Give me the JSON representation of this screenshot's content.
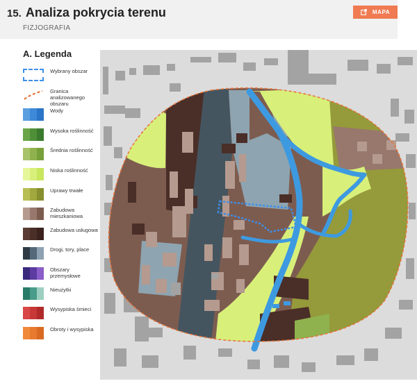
{
  "header": {
    "number": "15.",
    "title": "Analiza pokrycia terenu",
    "subtitle": "FIZJOGRAFIA",
    "map_button_label": "MAPA",
    "map_button_icon": "external-link-icon"
  },
  "legend": {
    "title": "A. Legenda",
    "items": [
      {
        "key": "selected-area",
        "label": "Wybrany obszar",
        "type": "frame",
        "colors": [
          "#3d8ee8"
        ]
      },
      {
        "key": "analysis-boundary",
        "label": "Granica analizowanego obszaru",
        "type": "line",
        "colors": [
          "#e8753a"
        ]
      },
      {
        "key": "water",
        "label": "Wody",
        "type": "ramp",
        "colors": [
          "#5a9fe0",
          "#3e89d8",
          "#2a75c8"
        ]
      },
      {
        "key": "high-vegetation",
        "label": "Wysoka roślinność",
        "type": "ramp",
        "colors": [
          "#6aa548",
          "#4f8f38",
          "#3a7a2c"
        ]
      },
      {
        "key": "medium-vegetation",
        "label": "Średnia roślinność",
        "type": "ramp",
        "colors": [
          "#a8c46a",
          "#8fb24e",
          "#77a03a"
        ]
      },
      {
        "key": "low-vegetation",
        "label": "Niska roślinność",
        "type": "ramp",
        "colors": [
          "#e6f79a",
          "#d8f07a",
          "#c8e65e"
        ]
      },
      {
        "key": "permanent-crops",
        "label": "Uprawy trwałe",
        "type": "ramp",
        "colors": [
          "#b8be54",
          "#a0a83e",
          "#888f2e"
        ]
      },
      {
        "key": "residential",
        "label": "Zabudowa mieszkaniowa",
        "type": "ramp",
        "colors": [
          "#b59a8f",
          "#98786c",
          "#7d5c50"
        ]
      },
      {
        "key": "services",
        "label": "Zabudowa usługowa",
        "type": "ramp",
        "colors": [
          "#5a3c34",
          "#4a2e28",
          "#3b221d"
        ]
      },
      {
        "key": "roads",
        "label": "Drogi, tory, place",
        "type": "ramp",
        "colors": [
          "#2e3b46",
          "#55687a",
          "#8da1b2"
        ]
      },
      {
        "key": "industrial",
        "label": "Obszary przemysłowe",
        "type": "ramp",
        "colors": [
          "#3b2a7c",
          "#5c3ca0",
          "#8a5ec8"
        ]
      },
      {
        "key": "wasteland",
        "label": "Nieużytki",
        "type": "ramp",
        "colors": [
          "#2a7a6a",
          "#4a9c8a",
          "#9ccfc0"
        ]
      },
      {
        "key": "landfills",
        "label": "Wysypiska śmieci",
        "type": "ramp",
        "colors": [
          "#d84646",
          "#c73838",
          "#b02a2a"
        ]
      },
      {
        "key": "storage",
        "label": "Obroty i wysypiska",
        "type": "ramp",
        "colors": [
          "#f08a3a",
          "#e87a30",
          "#d86a22"
        ]
      }
    ]
  },
  "map": {
    "colors": {
      "background": "#dcdcdc",
      "buildings": "#a3a3a3",
      "residential": "#7d5c50",
      "residential_light": "#98786c",
      "services": "#4a2e28",
      "low_vegetation": "#d8f07a",
      "permanent_crops": "#959a3a",
      "medium_vegetation": "#8fb24e",
      "roads_dark": "#45555f",
      "roads_light": "#8ea4b0",
      "water": "#3e9ae0",
      "boundary": "#e8753a",
      "selection": "#3d8ee8"
    }
  }
}
